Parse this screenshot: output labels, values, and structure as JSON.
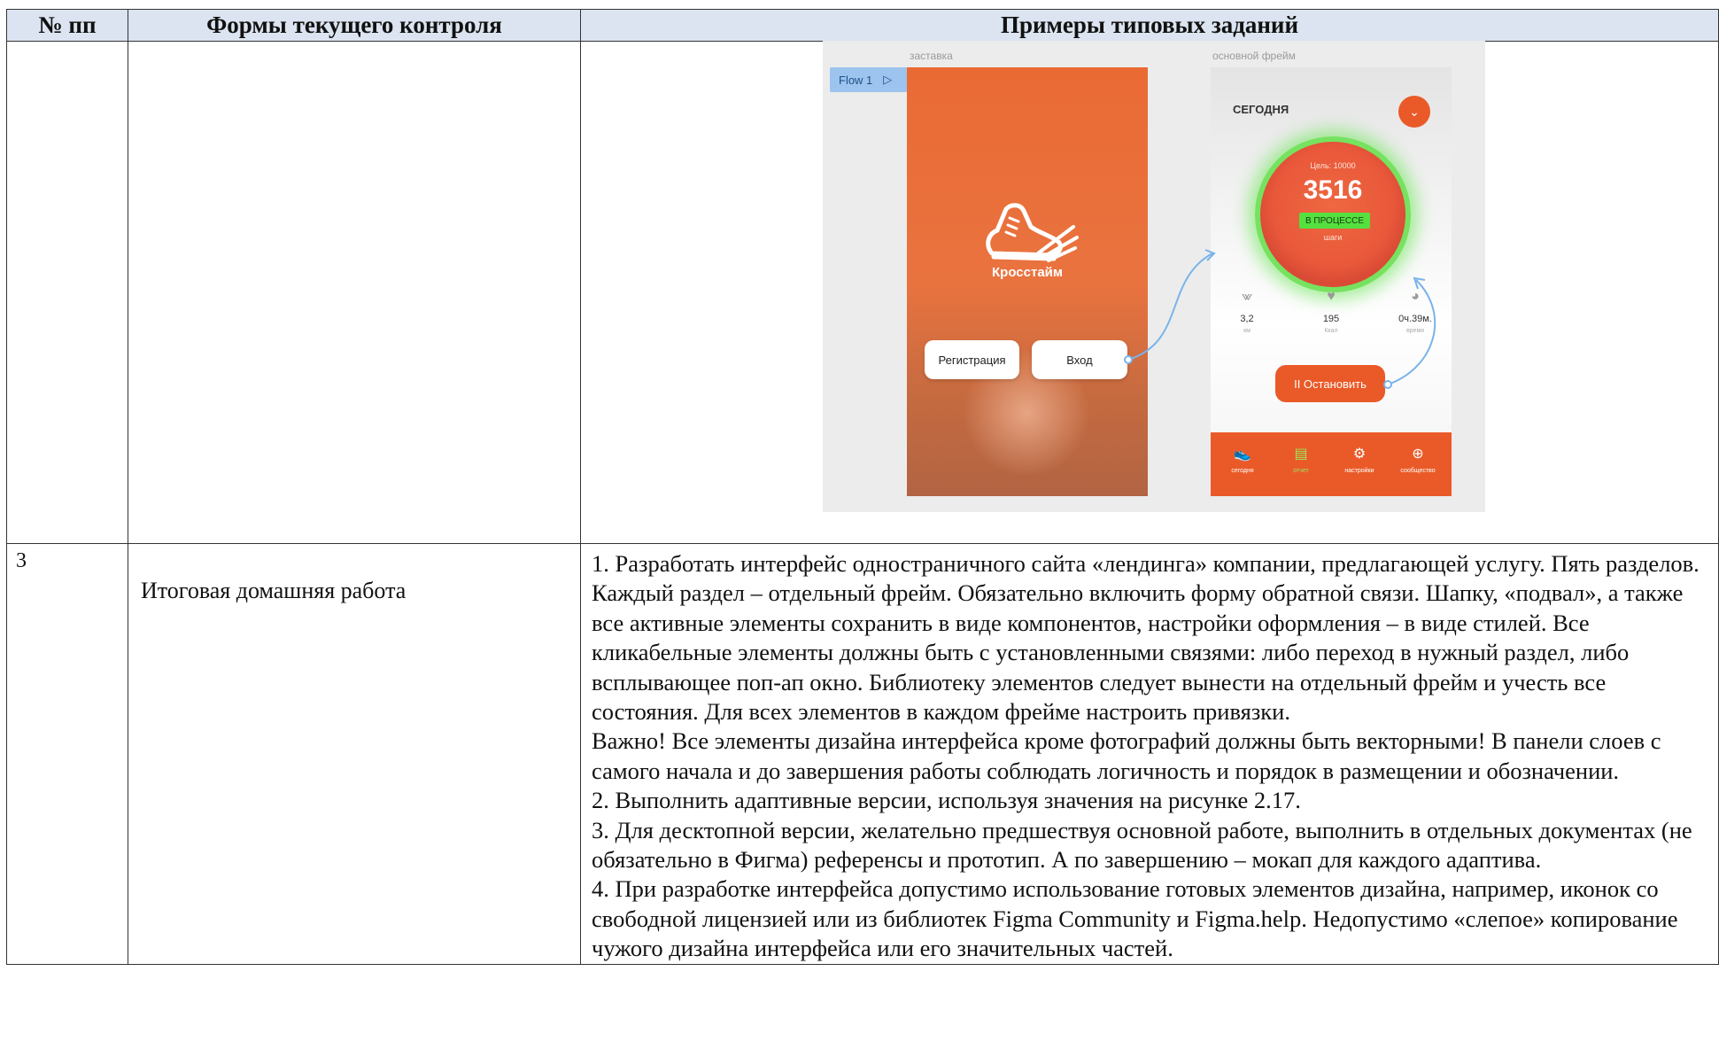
{
  "table": {
    "headers": [
      "№ пп",
      "Формы текущего контроля",
      "Примеры типовых заданий"
    ],
    "row3": {
      "number": "3",
      "form": "Итоговая домашняя работа",
      "tasks": [
        "1. Разработать интерфейс одностраничного сайта «лендинга» компании, предлагающей услугу. Пять разделов. Каждый раздел – отдельный фрейм. Обязательно включить форму обратной связи. Шапку, «подвал», а также все активные элементы сохранить в виде компонентов, настройки оформления – в виде стилей. Все кликабельные элементы должны быть с установленными связями: либо переход в нужный раздел, либо всплывающее поп-ап окно. Библиотеку элементов следует вынести на отдельный фрейм и учесть все состояния. Для всех элементов в каждом фрейме настроить привязки.",
        "Важно! Все элементы дизайна интерфейса кроме фотографий должны быть векторными! В панели слоев с самого начала и до завершения работы соблюдать логичность и порядок в размещении и обозначении.",
        "2. Выполнить адаптивные версии, используя значения на рисунке 2.17.",
        "3. Для десктопной версии, желательно предшествуя основной работе, выполнить в отдельных документах (не обязательно в Фигма) референсы и прототип. А по завершению – мокап для каждого адаптива.",
        "4. При разработке интерфейса допустимо использование готовых элементов дизайна, например, иконок со свободной лицензией или из библиотек Figma Community и Figma.help. Недопустимо «слепое» копирование чужого дизайна интерфейса или его значительных частей."
      ]
    }
  },
  "prototype": {
    "frame_label_splash": "заставка",
    "frame_label_main": "основной фрейм",
    "flow_label": "Flow 1",
    "brand_name": "Кросстайм",
    "register_button": "Регистрация",
    "login_button": "Вход",
    "today_label": "СЕГОДНЯ",
    "goal_text": "Цель: 10000",
    "steps_value": "3516",
    "status_badge": "В ПРОЦЕССЕ",
    "steps_unit": "шаги",
    "stats": [
      {
        "value": "3,2",
        "label": "км",
        "icon": "share-icon"
      },
      {
        "value": "195",
        "label": "Ккал",
        "icon": "heart-icon"
      },
      {
        "value": "0ч.39м.",
        "label": "время",
        "icon": "clock-icon"
      }
    ],
    "stop_button": "II Остановить",
    "tabs": [
      {
        "label": "сегодня",
        "icon": "sneaker-icon"
      },
      {
        "label": "отчет",
        "icon": "bar-chart-icon"
      },
      {
        "label": "настройки",
        "icon": "gear-icon"
      },
      {
        "label": "сообщество",
        "icon": "globe-icon"
      }
    ],
    "colors": {
      "accent": "#ea5a28",
      "progress_ring": "#76e25f",
      "flow_tag": "#9cc4ef"
    }
  }
}
